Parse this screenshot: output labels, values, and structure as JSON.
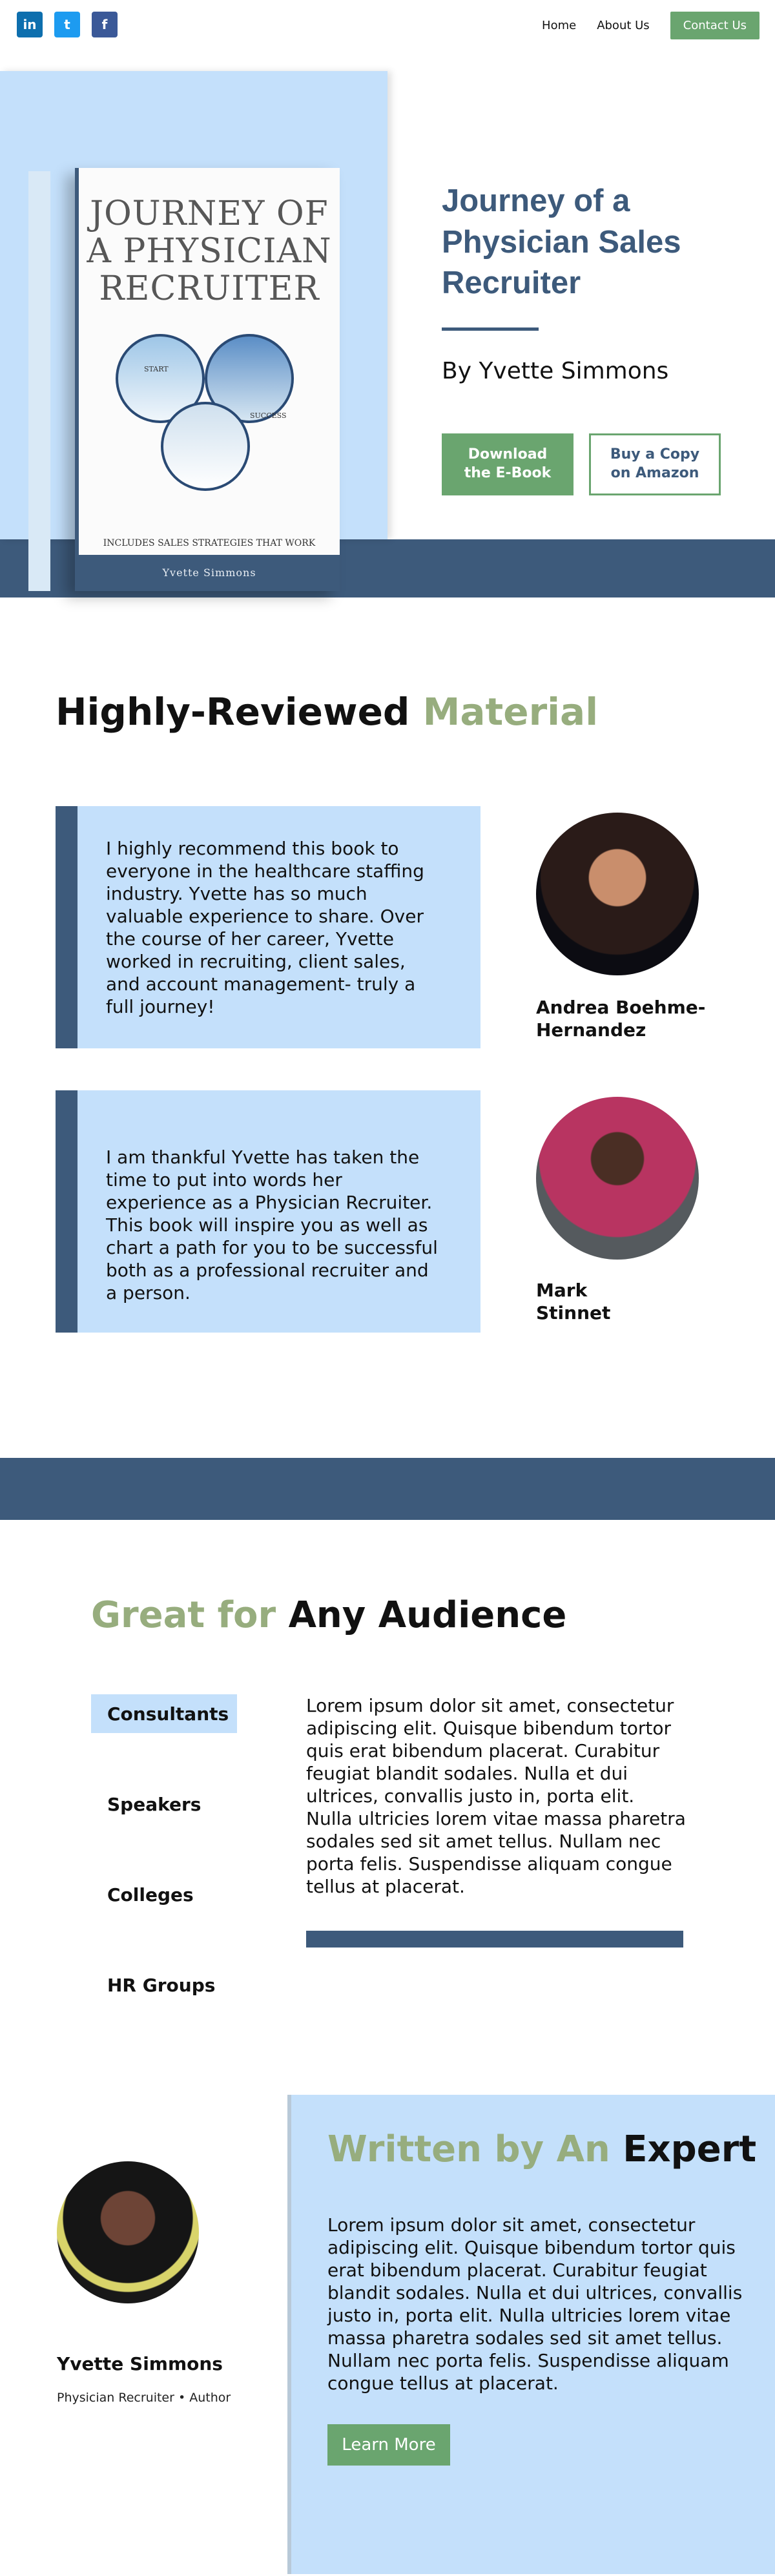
{
  "header": {
    "social": [
      {
        "icon": "linkedin-icon",
        "glyph": "in"
      },
      {
        "icon": "twitter-icon",
        "glyph": "t"
      },
      {
        "icon": "facebook-icon",
        "glyph": "f"
      }
    ],
    "nav": {
      "home": "Home",
      "about": "About Us",
      "contact": "Contact Us"
    }
  },
  "hero": {
    "book": {
      "title": "JOURNEY OF A PHYSICIAN RECRUITER",
      "start_label": "START",
      "success_label": "SUCCESS",
      "tagline": "INCLUDES SALES STRATEGIES THAT WORK",
      "author": "Yvette Simmons"
    },
    "title": "Journey of a Physician Sales Recruiter",
    "author": "By Yvette Simmons",
    "download_button": "Download the E-Book",
    "amazon_button": "Buy a Copy on Amazon"
  },
  "reviews": {
    "title_main": "Highly-Reviewed",
    "title_accent": "Material",
    "items": [
      {
        "text": "I highly recommend this book to everyone in the healthcare staffing industry. Yvette has so much valuable experience to share. Over the course of her career, Yvette worked in recruiting, client sales, and account management- truly a full journey!",
        "name": "Andrea Boehme-Hernandez"
      },
      {
        "text": "I am thankful Yvette has taken the time to put into words her experience as a Physician Recruiter. This book will inspire you as well as chart a path for you to be successful both as a professional recruiter and a person.",
        "name": "Mark Stinnet"
      }
    ]
  },
  "audience": {
    "title_accent": "Great for",
    "title_main": "Any Audience",
    "tabs": [
      "Consultants",
      "Speakers",
      "Colleges",
      "HR Groups"
    ],
    "text": "Lorem ipsum dolor sit amet, consectetur adipiscing elit. Quisque bibendum tortor quis erat bibendum placerat. Curabitur feugiat blandit sodales. Nulla et dui ultrices, convallis justo in, porta elit. Nulla ultricies lorem vitae massa pharetra sodales sed sit amet tellus. Nullam nec porta felis. Suspendisse aliquam congue tellus at placerat."
  },
  "author": {
    "name": "Yvette Simmons",
    "role": "Physician Recruiter  •  Author",
    "title_accent": "Written by An",
    "title_main": "Expert",
    "text": "Lorem ipsum dolor sit amet, consectetur adipiscing elit. Quisque bibendum tortor quis erat bibendum placerat. Curabitur feugiat blandit sodales. Nulla et dui ultrices, convallis justo in, porta elit. Nulla ultricies lorem vitae massa pharetra sodales sed sit amet tellus. Nullam nec porta felis. Suspendisse aliquam congue tellus at placerat.",
    "learn_more": "Learn More"
  },
  "colors": {
    "navy": "#3d5a7b",
    "light_blue": "#c4e0fb",
    "green": "#6aa56f",
    "sage_accent": "#97ad7e"
  }
}
